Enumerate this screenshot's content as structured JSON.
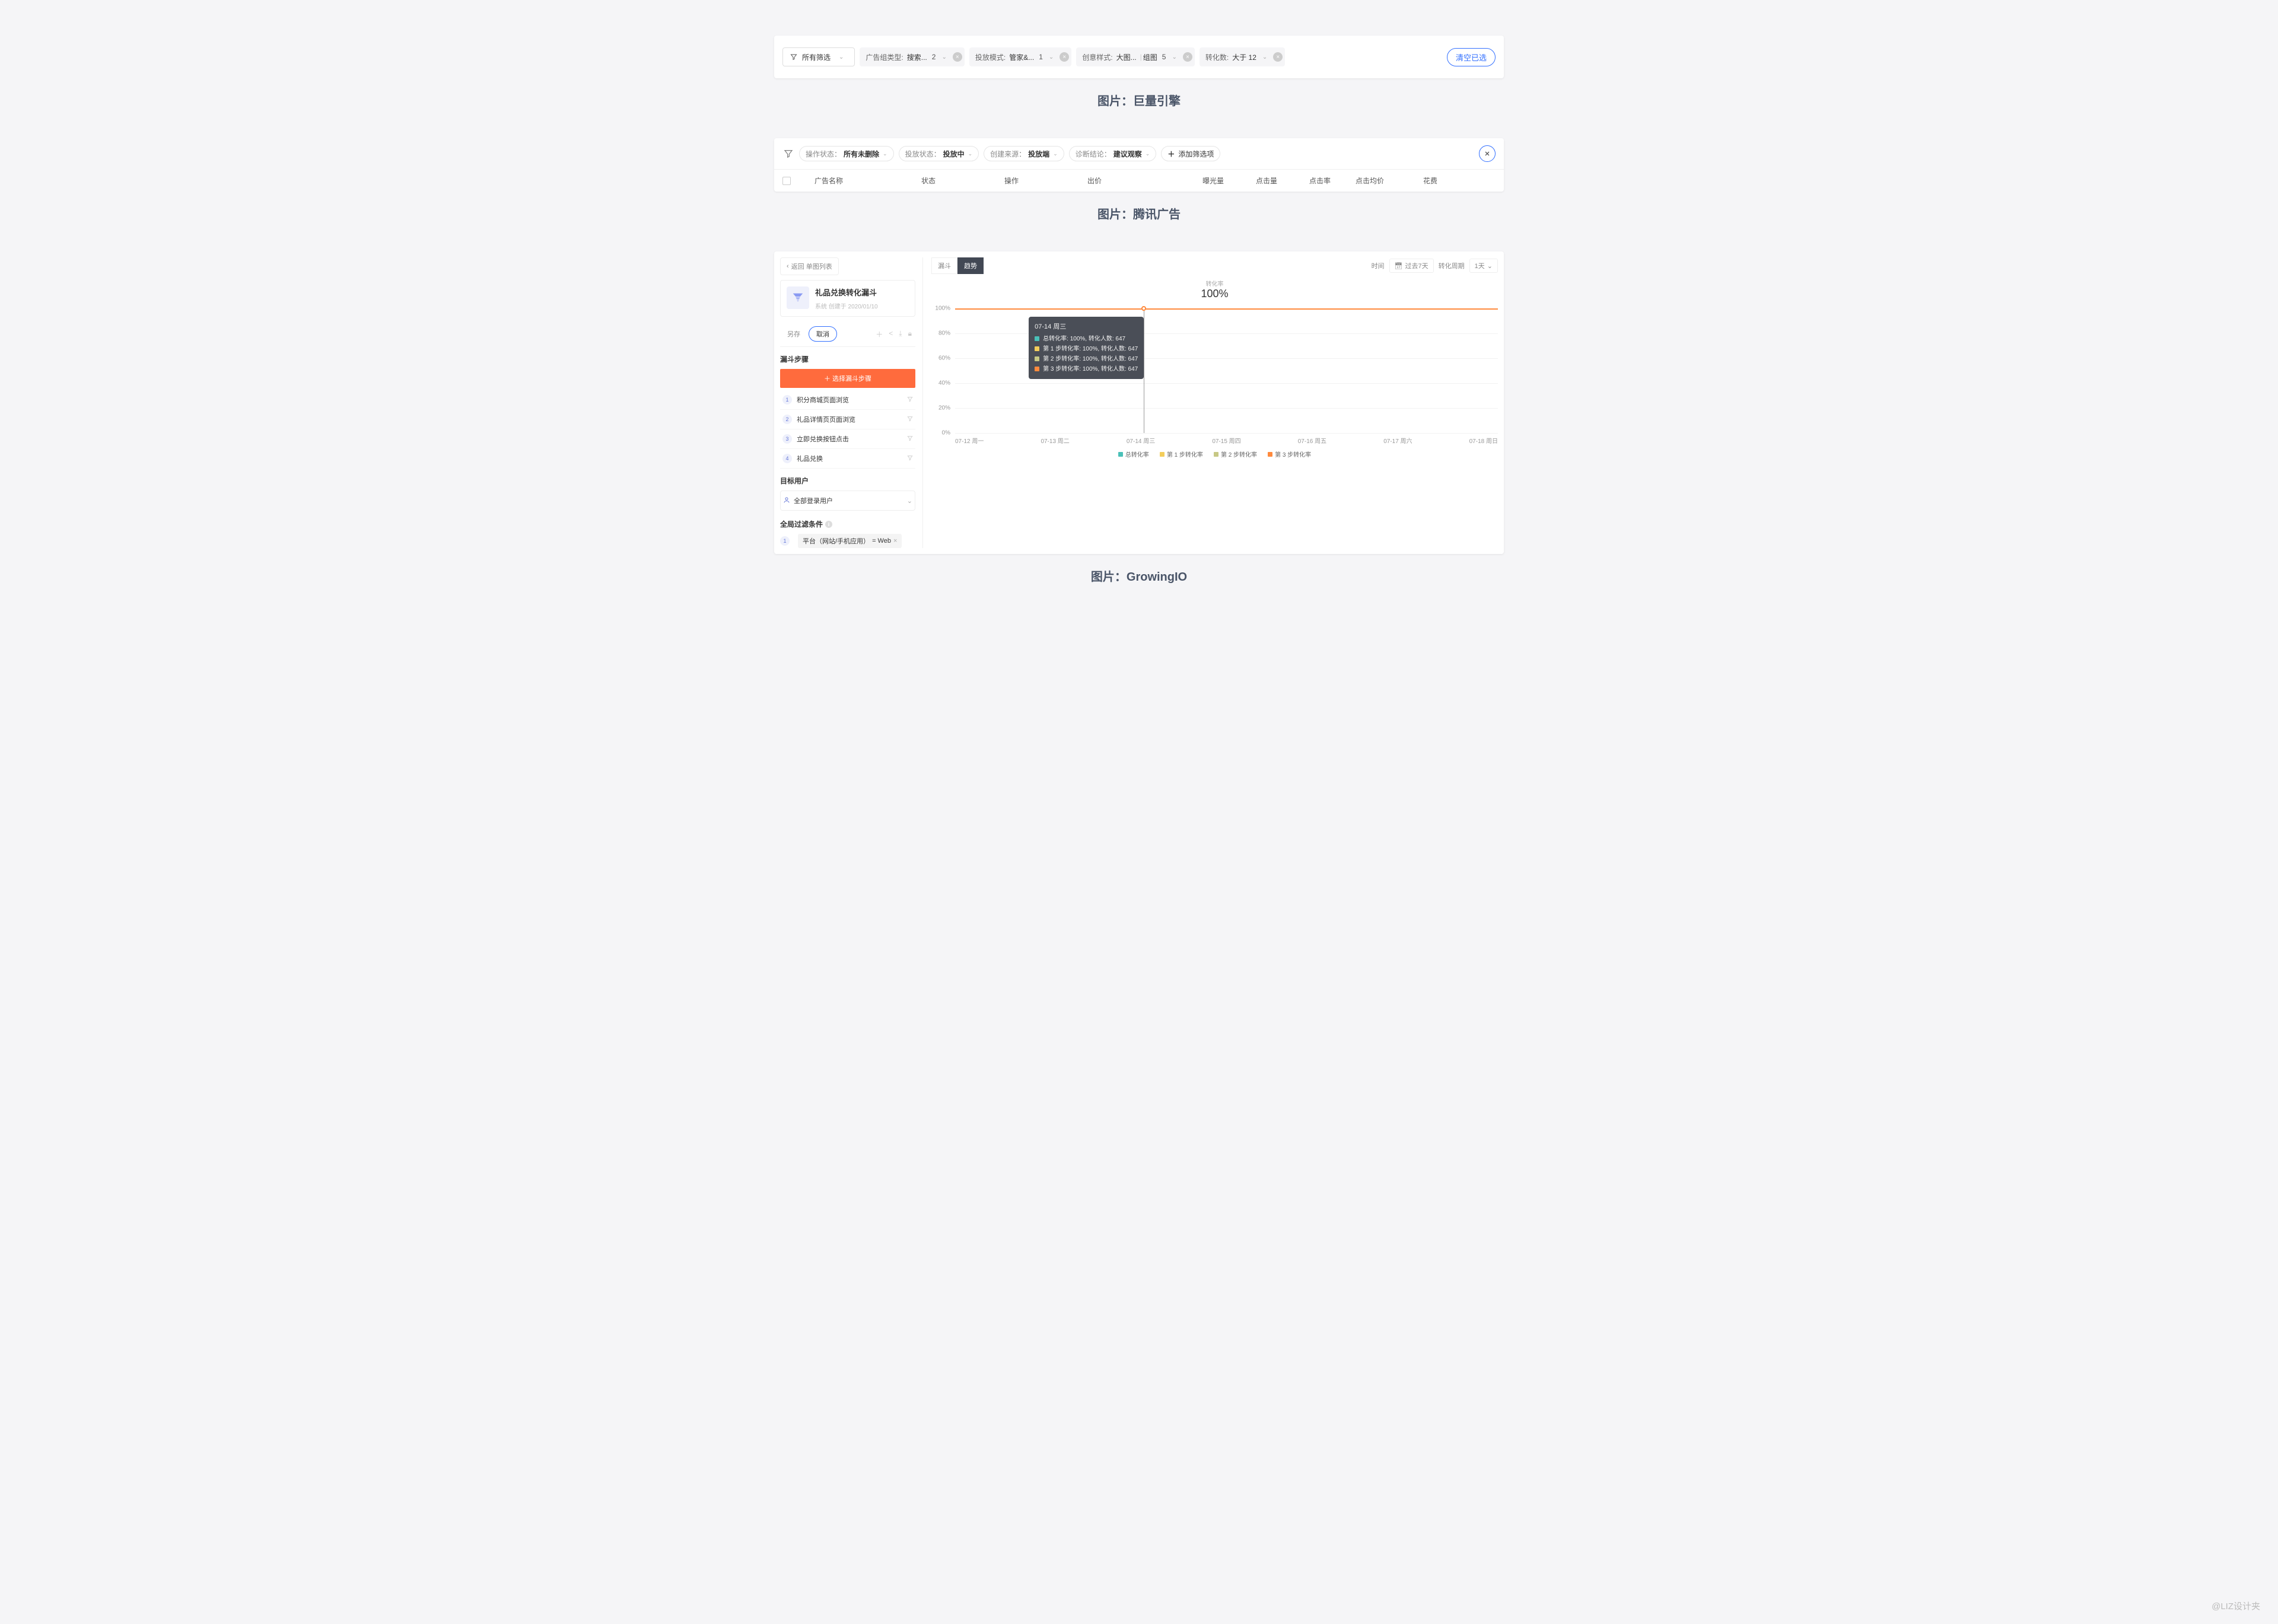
{
  "captions": {
    "s1": "图片：巨量引擎",
    "s2": "图片：腾讯广告",
    "s3": "图片：GrowingIO"
  },
  "s1": {
    "allFilters": "所有筛选",
    "filters": [
      {
        "label": "广告组类型:",
        "value": "搜索...",
        "count": "2"
      },
      {
        "label": "投放模式:",
        "value": "管家&...",
        "count": "1"
      },
      {
        "label": "创意样式:",
        "value": "大图...",
        "extra": "组图",
        "count": "5"
      },
      {
        "label": "转化数:",
        "value": "大于 12"
      }
    ],
    "clear": "清空已选"
  },
  "s2": {
    "chips": [
      {
        "lbl": "操作状态：",
        "val": "所有未删除"
      },
      {
        "lbl": "投放状态：",
        "val": "投放中"
      },
      {
        "lbl": "创建来源：",
        "val": "投放端"
      },
      {
        "lbl": "诊断结论：",
        "val": "建议观察"
      }
    ],
    "addFilter": "添加筛选项",
    "cols": [
      "广告名称",
      "状态",
      "操作",
      "出价",
      "曝光量",
      "点击量",
      "点击率",
      "点击均价",
      "花费"
    ]
  },
  "s3": {
    "back": "返回 单图列表",
    "title": "礼品兑换转化漏斗",
    "meta": "系统 创建于 2020/01/10",
    "saveAs": "另存",
    "cancel": "取消",
    "stepsTitle": "漏斗步骤",
    "addStep": "＋ 选择漏斗步骤",
    "steps": [
      "积分商城页面浏览",
      "礼品详情页页面浏览",
      "立即兑换按钮点击",
      "礼品兑换"
    ],
    "targetTitle": "目标用户",
    "targetUser": "全部登录用户",
    "globalCondTitle": "全局过滤条件",
    "cond": {
      "field": "平台（网站/手机应用）",
      "op": "= Web"
    },
    "tabs": {
      "funnel": "漏斗",
      "trend": "趋势"
    },
    "timeLabel": "时间",
    "timeValue": "过去7天",
    "cycleLabel": "转化周期",
    "cycleValue": "1天",
    "chartSub": "转化率",
    "chartBig": "100%",
    "tooltip": {
      "head": "07-14 周三",
      "rows": [
        {
          "color": "#4ac0b8",
          "text": "总转化率: 100%, 转化人数: 647"
        },
        {
          "color": "#f3cd5b",
          "text": "第 1 步转化率: 100%, 转化人数: 647"
        },
        {
          "color": "#c7c885",
          "text": "第 2 步转化率: 100%, 转化人数: 647"
        },
        {
          "color": "#ff8a3d",
          "text": "第 3 步转化率: 100%, 转化人数: 647"
        }
      ]
    },
    "legend": [
      {
        "color": "#4ac0b8",
        "text": "总转化率"
      },
      {
        "color": "#f3cd5b",
        "text": "第 1 步转化率"
      },
      {
        "color": "#c7c885",
        "text": "第 2 步转化率"
      },
      {
        "color": "#ff8a3d",
        "text": "第 3 步转化率"
      }
    ]
  },
  "chart_data": {
    "type": "line",
    "title": "转化率",
    "ylabel": "",
    "ylim": [
      0,
      100
    ],
    "yticks": [
      "0%",
      "20%",
      "40%",
      "60%",
      "80%",
      "100%"
    ],
    "categories": [
      "07-12 周一",
      "07-13 周二",
      "07-14 周三",
      "07-15 周四",
      "07-16 周五",
      "07-17 周六",
      "07-18 周日"
    ],
    "series": [
      {
        "name": "总转化率",
        "values": [
          100,
          100,
          100,
          100,
          100,
          100,
          100
        ]
      },
      {
        "name": "第 1 步转化率",
        "values": [
          100,
          100,
          100,
          100,
          100,
          100,
          100
        ]
      },
      {
        "name": "第 2 步转化率",
        "values": [
          100,
          100,
          100,
          100,
          100,
          100,
          100
        ]
      },
      {
        "name": "第 3 步转化率",
        "values": [
          100,
          100,
          100,
          100,
          100,
          100,
          100
        ]
      }
    ]
  },
  "watermark": "@LIZ设计夹"
}
